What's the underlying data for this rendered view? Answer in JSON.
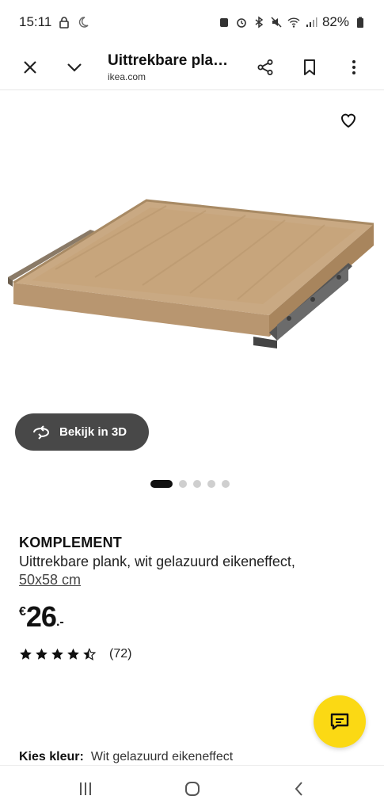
{
  "status_bar": {
    "time": "15:11",
    "battery": "82%"
  },
  "toolbar": {
    "title": "Uittrekbare plank...",
    "domain": "ikea.com",
    "icons": [
      "close-icon",
      "chevron-down-icon",
      "share-icon",
      "bookmark-icon",
      "more-vert-icon"
    ]
  },
  "gallery": {
    "view3d_label": "Bekijk in 3D",
    "image_count": 5,
    "active_image_index": 0
  },
  "product": {
    "name": "KOMPLEMENT",
    "description": "Uittrekbare plank, wit gelazuurd eikeneffect,",
    "size": "50x58 cm",
    "price_currency": "€",
    "price_integer": "26",
    "price_decimal": ".-",
    "rating_stars": 4.5,
    "rating_count": "(72)"
  },
  "color_selector": {
    "label": "Kies kleur:",
    "value": "Wit gelazuurd eikeneffect"
  },
  "colors": {
    "chat_fab": "#fbd914",
    "view3d_bg": "#484848",
    "wood": "#c9a983"
  }
}
